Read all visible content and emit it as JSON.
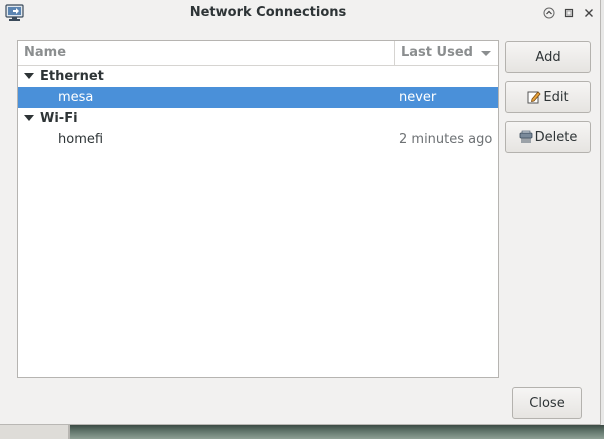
{
  "window": {
    "title": "Network Connections"
  },
  "titlebar_buttons": [
    "up-icon",
    "restore-icon",
    "close-icon"
  ],
  "table": {
    "columns": {
      "name": "Name",
      "last_used": "Last Used"
    },
    "groups": [
      {
        "label": "Ethernet",
        "connections": [
          {
            "name": "mesa",
            "last_used": "never",
            "selected": true
          }
        ]
      },
      {
        "label": "Wi-Fi",
        "connections": [
          {
            "name": "homefi",
            "last_used": "2 minutes ago",
            "selected": false
          }
        ]
      }
    ]
  },
  "buttons": {
    "add": "Add",
    "edit": "Edit",
    "delete": "Delete",
    "close": "Close"
  },
  "colors": {
    "selection": "#4a90d9",
    "window_bg": "#f2f1f0"
  }
}
